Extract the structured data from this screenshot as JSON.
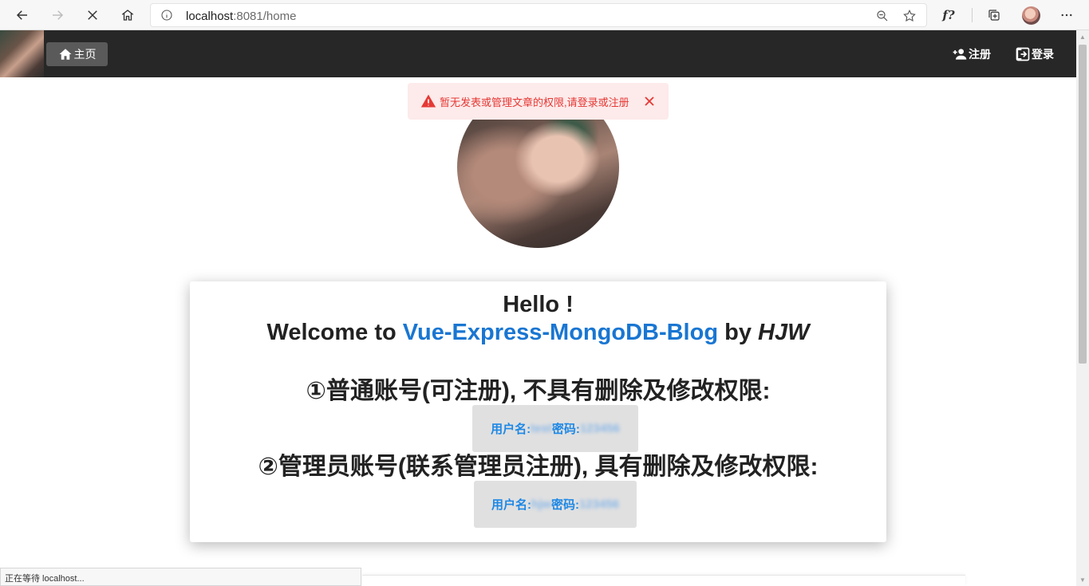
{
  "browser": {
    "url_host": "localhost",
    "url_rest": ":8081/home"
  },
  "navbar": {
    "home_label": "主页",
    "register_label": "注册",
    "login_label": "登录"
  },
  "alert": {
    "message": "暂无发表或管理文章的权限,请登录或注册",
    "color": "#e53935"
  },
  "card": {
    "hello": "Hello !",
    "welcome_prefix": "Welcome to ",
    "project_name": "Vue-Express-MongoDB-Blog",
    "by": " by ",
    "author": "HJW",
    "normal_account_title": "①普通账号(可注册), 不具有删除及修改权限:",
    "normal_credentials_prefix": "用户名: ",
    "normal_username": "test",
    "normal_password_label": " 密码: ",
    "normal_password": "123456",
    "admin_account_title": "②管理员账号(联系管理员注册), 具有删除及修改权限:",
    "admin_credentials_prefix": "用户名: ",
    "admin_username": "hjw",
    "admin_password_label": " 密码: ",
    "admin_password": "123456"
  },
  "status_bar": {
    "text": "正在等待 localhost..."
  },
  "colors": {
    "navbar_bg": "#272727",
    "accent_blue": "#1976d2",
    "alert_bg": "#fdeaea"
  }
}
